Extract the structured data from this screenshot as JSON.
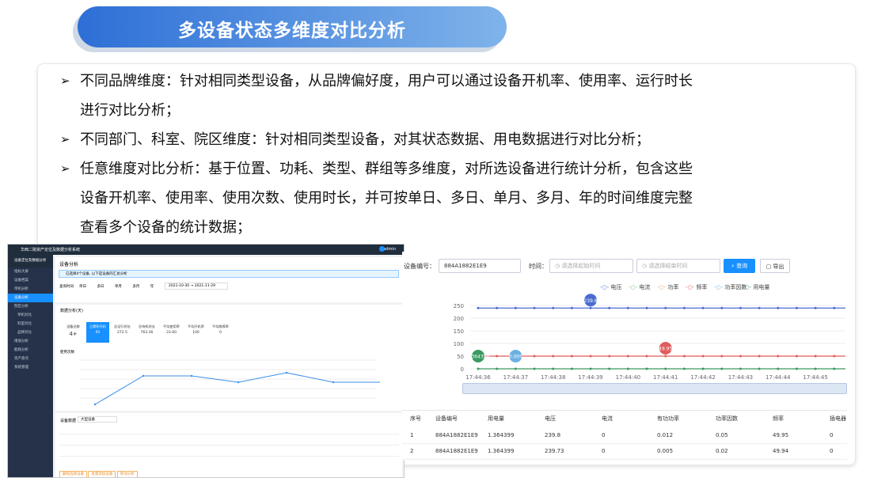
{
  "title": "多设备状态多维度对比分析",
  "bullets": [
    "不同品牌维度：针对相同类型设备，从品牌偏好度，用户可以通过设备开机率、使用率、运行时长",
    "进行对比分析；",
    "不同部门、科室、院区维度：针对相同类型设备，对其状态数据、用电数据进行对比分析；",
    "任意维度对比分析：基于位置、功耗、类型、群组等多维度，对所选设备进行统计分析，包含这些",
    "设备开机率、使用率、使用次数、使用时长，并可按单日、多日、单月、多月、年的时间维度完整",
    "查看多个设备的统计数据；"
  ],
  "left_app": {
    "system_title": "华西二院资产定位及数据分析系统",
    "user": "admin",
    "sidebar_head": "设备定位及数据分析",
    "sidebar_items": [
      "指标大屏",
      "设备档案",
      "单机分析",
      "设备分析",
      "院区分析",
      "单机对比",
      "科室对比",
      "品牌对比",
      "增值分析",
      "能耗分析",
      "资产盘点",
      "系统管理"
    ],
    "page_title": "设备分析",
    "notice": "已选择4个设备, 以下是设备的汇总分析",
    "filter_label": "查询时间",
    "filter_options": [
      "单日",
      "多日",
      "单月",
      "多月",
      "年"
    ],
    "date_from": "2021-10-30",
    "date_to": "2021-11-29",
    "section_title": "数据分析(天)",
    "stats": [
      {
        "label": "设备总数",
        "value": "4+"
      },
      {
        "label": "日累积开机",
        "value": "95"
      },
      {
        "label": "总运行时长",
        "value": "272.5"
      },
      {
        "label": "总待机时长",
        "value": "763.36"
      },
      {
        "label": "平均使用率",
        "value": "33.60"
      },
      {
        "label": "平均开机率",
        "value": "100"
      },
      {
        "label": "平均故障率",
        "value": "0"
      }
    ],
    "chart_label": "使用次数",
    "list_title": "设备数据",
    "list_filter": "大型设备",
    "footer_buttons": [
      "删除选择设备",
      "批量添加设备",
      "移动分析"
    ]
  },
  "right_app": {
    "device_label": "设备编号：",
    "device_value": "884A1882E1E9",
    "time_label": "时间：",
    "start_placeholder": "请选择起始时间",
    "end_placeholder": "请选择结束时间",
    "query_btn": "查询",
    "export_btn": "导出",
    "legend": [
      "电压",
      "电流",
      "功率",
      "频率",
      "功率因数",
      "用电量"
    ],
    "legend_colors": [
      "#4a6bd0",
      "#6cc46c",
      "#e8a060",
      "#e05c5c",
      "#6cb0e0",
      "#3a9a60"
    ],
    "y_ticks": [
      "250",
      "200",
      "150",
      "100",
      "50",
      "0"
    ],
    "x_ticks": [
      "17:44:36",
      "17:44:37",
      "17:44:38",
      "17:44:39",
      "17:44:40",
      "17:44:41",
      "17:44:42",
      "17:44:43",
      "17:44:44",
      "17:44:45"
    ],
    "markers": [
      {
        "value": "239.8",
        "series": "电压"
      },
      {
        "value": "49.95",
        "series": "频率"
      },
      {
        "value": "1.364399",
        "series": "用电量"
      },
      {
        "value": "0.005",
        "series": "功率因数"
      }
    ],
    "table_headers": [
      "序号",
      "设备编号",
      "用电量",
      "电压",
      "电流",
      "有功功率",
      "功率因数",
      "频率",
      "插电器"
    ],
    "table_rows": [
      [
        "1",
        "884A1882E1E9",
        "1.364399",
        "239.8",
        "0",
        "0.012",
        "0.05",
        "49.95",
        "0"
      ],
      [
        "2",
        "884A1882E1E9",
        "1.364399",
        "239.73",
        "0",
        "0.005",
        "0.02",
        "49.94",
        "0"
      ]
    ]
  }
}
